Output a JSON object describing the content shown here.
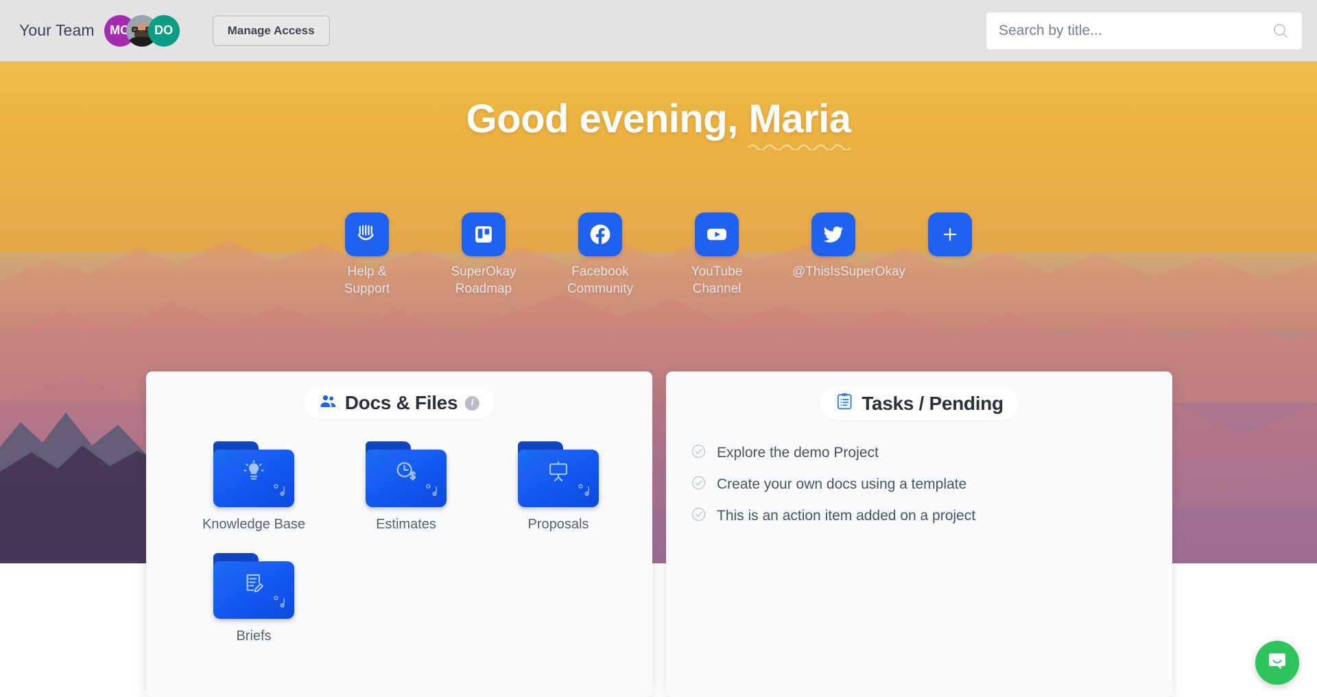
{
  "topbar": {
    "team_label": "Your Team",
    "avatars": [
      {
        "name": "avatar-mo",
        "initials": "MO",
        "color": "#a32bb0",
        "type": "initials"
      },
      {
        "name": "avatar-photo",
        "initials": "",
        "color": "#9aa4ad",
        "type": "photo"
      },
      {
        "name": "avatar-do",
        "initials": "DO",
        "color": "#0d9d82",
        "type": "initials"
      }
    ],
    "manage_access_label": "Manage Access",
    "search": {
      "placeholder": "Search by title...",
      "value": "",
      "icon": "search-icon"
    }
  },
  "hero": {
    "greeting_prefix": "Good evening, ",
    "greeting_name": "Maria",
    "shortcuts": [
      {
        "id": "help-support",
        "icon": "intercom-icon",
        "label": "Help &\nSupport",
        "label_line1": "Help &",
        "label_line2": "Support"
      },
      {
        "id": "superokay-roadmap",
        "icon": "trello-icon",
        "label": "SuperOkay\nRoadmap",
        "label_line1": "SuperOkay",
        "label_line2": "Roadmap"
      },
      {
        "id": "facebook-community",
        "icon": "facebook-icon",
        "label": "Facebook\nCommunity",
        "label_line1": "Facebook",
        "label_line2": "Community"
      },
      {
        "id": "youtube-channel",
        "icon": "youtube-icon",
        "label": "YouTube\nChannel",
        "label_line1": "YouTube",
        "label_line2": "Channel"
      },
      {
        "id": "twitter-handle",
        "icon": "twitter-icon",
        "label": "@ThisIsSuperOkay",
        "label_line1": "@ThisIsSuperOkay",
        "label_line2": ""
      },
      {
        "id": "add-shortcut",
        "icon": "plus-icon",
        "label": "",
        "label_line1": "",
        "label_line2": ""
      }
    ]
  },
  "docs_card": {
    "title": "Docs & Files",
    "title_icon": "people-icon",
    "info_icon": "info-icon",
    "info_glyph": "i",
    "folders": [
      {
        "id": "knowledge-base",
        "label": "Knowledge Base",
        "glyph": "lightbulb-icon",
        "shared": true
      },
      {
        "id": "estimates",
        "label": "Estimates",
        "glyph": "clock-dollar-icon",
        "shared": true
      },
      {
        "id": "proposals",
        "label": "Proposals",
        "glyph": "presentation-icon",
        "shared": true
      },
      {
        "id": "briefs",
        "label": "Briefs",
        "glyph": "clipboard-pencil-icon",
        "shared": true
      }
    ]
  },
  "tasks_card": {
    "title": "Tasks / Pending",
    "title_icon": "clipboard-list-icon",
    "items": [
      {
        "id": "task-1",
        "label": "Explore the demo Project",
        "state": "check-circle-icon"
      },
      {
        "id": "task-2",
        "label": "Create your own docs using a template",
        "state": "check-circle-icon"
      },
      {
        "id": "task-3",
        "label": "This is an action item added on a project",
        "state": "check-circle-icon"
      }
    ]
  },
  "support_widget": {
    "icon": "intercom-chat-icon",
    "color": "#2ec45c"
  },
  "colors": {
    "accent_blue": "#1f61f0",
    "topbar_bg": "#e3e3e3",
    "card_bg": "#f9fafb",
    "text_dark": "#2b2f3a",
    "text_muted": "#5a5f6b"
  }
}
